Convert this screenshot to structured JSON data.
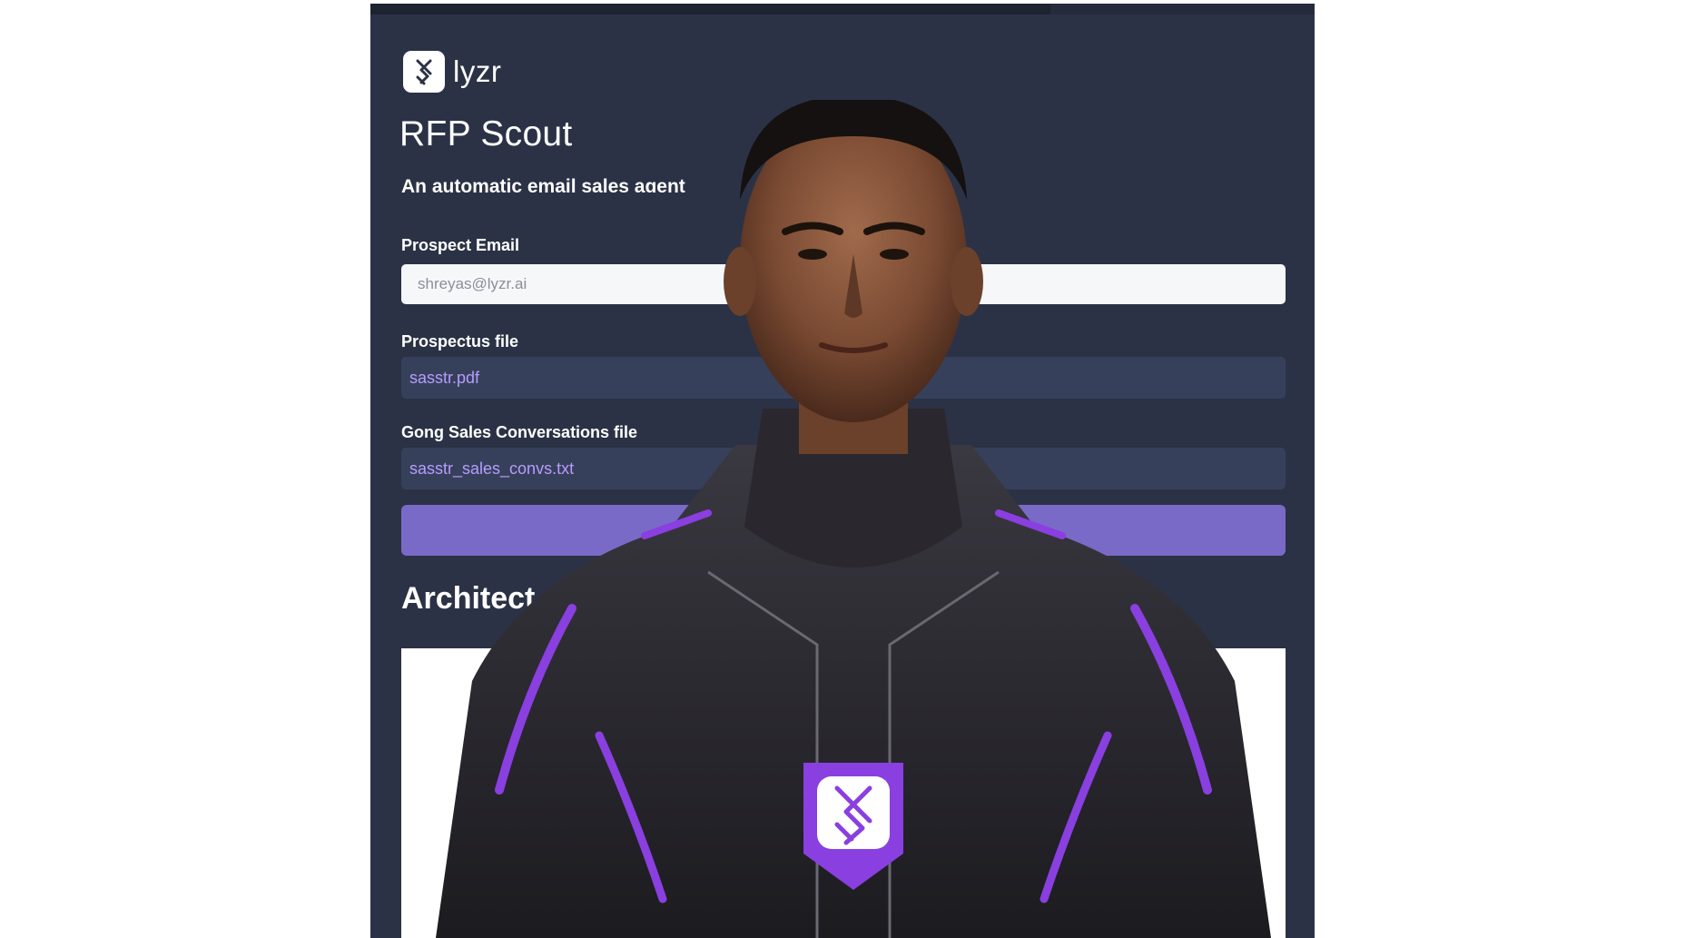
{
  "app": {
    "brand": "lyzr",
    "title": "RFP Scout",
    "subtitle": "An automatic email sales agent"
  },
  "form": {
    "email_label": "Prospect Email",
    "email_value": "shreyas@lyzr.ai",
    "prospectus_label": "Prospectus file",
    "prospectus_file": "sasstr.pdf",
    "gong_label": "Gong Sales Conversations file",
    "gong_file": "sasstr_sales_convs.txt",
    "submit_label": ""
  },
  "section": {
    "heading": "Architect"
  },
  "colors": {
    "background": "#2b3245",
    "accent": "#7a6ac7",
    "file_text": "#b79cff",
    "suit_purple": "#8a3fe0"
  },
  "icons": {
    "brand": "lyzr-logo-icon",
    "badge": "lyzr-badge-icon"
  }
}
